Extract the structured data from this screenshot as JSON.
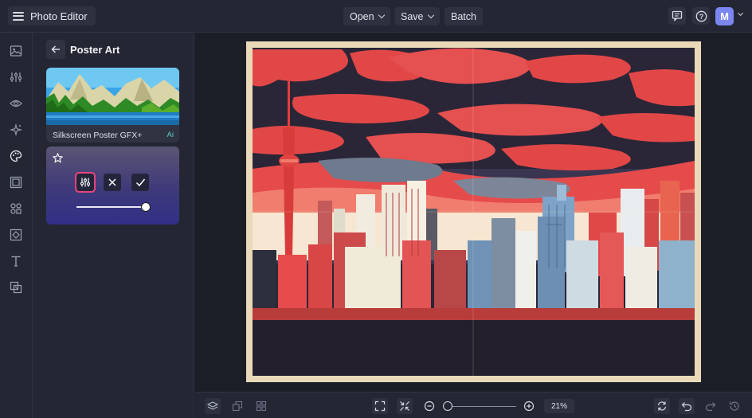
{
  "app": {
    "title": "Photo Editor",
    "avatar_letter": "M"
  },
  "toolbar": {
    "open_label": "Open",
    "save_label": "Save",
    "batch_label": "Batch"
  },
  "panel": {
    "title": "Poster Art",
    "effect": {
      "name": "Silkscreen Poster GFX+",
      "badge": "Ai"
    },
    "intensity": 0.92
  },
  "zoom": {
    "level": "21%",
    "slider": 0.0
  },
  "colors": {
    "accent": "#e8447a",
    "avatar": "#7c86f0",
    "ai_badge": "#5fd0c8"
  },
  "icons": {
    "rail": [
      "image-icon",
      "adjust-icon",
      "eye-icon",
      "effects-icon",
      "palette-icon",
      "frame-icon",
      "graphics-icon",
      "texture-icon",
      "text-icon",
      "layers-overlay-icon"
    ],
    "bottom": [
      "layers-icon",
      "resize-icon",
      "grid-icon",
      "fit-screen-icon",
      "actual-size-icon",
      "zoom-out-icon",
      "zoom-in-icon",
      "refresh-icon",
      "undo-icon",
      "redo-icon",
      "history-icon"
    ]
  }
}
